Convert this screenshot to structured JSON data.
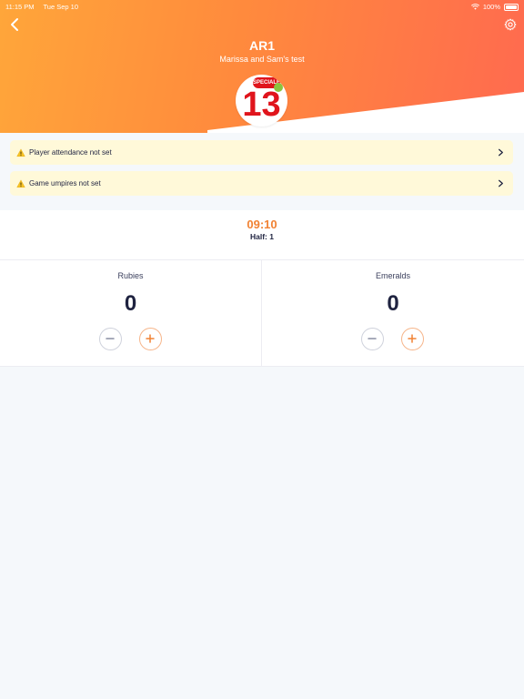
{
  "status_bar": {
    "time": "11:15 PM",
    "date": "Tue Sep 10",
    "battery": "100%"
  },
  "header": {
    "title": "AR1",
    "subtitle": "Marissa and Sam's test"
  },
  "logo": {
    "badge": "SPECIALE",
    "number": "13"
  },
  "alerts": [
    {
      "text": "Player attendance not set"
    },
    {
      "text": "Game umpires not set"
    }
  ],
  "clock": {
    "time": "09:10",
    "half": "Half: 1"
  },
  "teams": [
    {
      "name": "Rubies",
      "score": "0"
    },
    {
      "name": "Emeralds",
      "score": "0"
    }
  ],
  "colors": {
    "accent": "#f18233",
    "warning_bg": "#fff9d9",
    "brand_red": "#e0141c"
  }
}
